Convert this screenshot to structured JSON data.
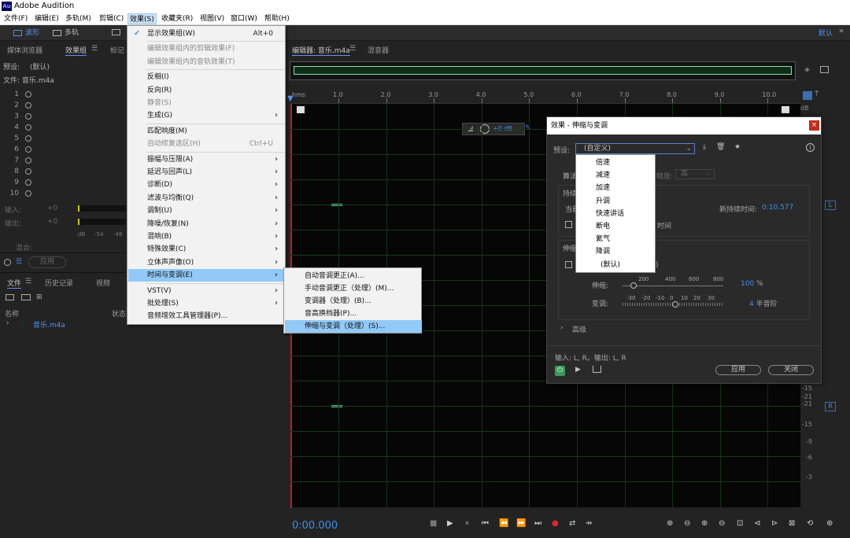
{
  "app": {
    "title": "Adobe Audition",
    "logo": "Au"
  },
  "menubar": [
    "文件(F)",
    "编辑(E)",
    "多轨(M)",
    "剪辑(C)",
    "效果(S)",
    "收藏夹(R)",
    "视图(V)",
    "窗口(W)",
    "帮助(H)"
  ],
  "toolbar": {
    "waveform": "波形",
    "multitrack": "多轨",
    "workspace": "默认"
  },
  "left_panel": {
    "tabs": [
      "媒体浏览器",
      "效果组",
      "标记"
    ],
    "preset_label": "预设:",
    "preset_value": "(默认)",
    "file_label": "文件: 音乐.m4a",
    "slots": [
      "1",
      "2",
      "3",
      "4",
      "5",
      "6",
      "7",
      "8",
      "9",
      "10"
    ],
    "input_label": "输入:",
    "output_label": "输出:",
    "mix_label": "混合:",
    "db_value": "+0",
    "meter_ticks": [
      "dB",
      "-54",
      "-48"
    ],
    "apply_button": "应用"
  },
  "files_panel": {
    "tabs": [
      "文件",
      "历史记录",
      "视频"
    ],
    "col_name": "名称",
    "col_status": "状态",
    "items": [
      "音乐.m4a"
    ]
  },
  "effects_menu": {
    "items": [
      {
        "label": "显示效果组(W)",
        "shortcut": "Alt+0",
        "checked": true
      },
      {
        "label": "编辑效果组内的剪辑效果(F)",
        "disabled": true
      },
      {
        "label": "编辑效果组内的音轨效果(T)",
        "disabled": true
      },
      {
        "label": "反相(I)"
      },
      {
        "label": "反向(R)"
      },
      {
        "label": "静音(S)",
        "disabled": true
      },
      {
        "label": "生成(G)",
        "submenu": true
      },
      {
        "label": "匹配响度(M)"
      },
      {
        "label": "自动修复选区(H)",
        "shortcut": "Ctrl+U",
        "disabled": true
      },
      {
        "label": "振幅与压限(A)",
        "submenu": true
      },
      {
        "label": "延迟与回声(L)",
        "submenu": true
      },
      {
        "label": "诊断(D)",
        "submenu": true
      },
      {
        "label": "滤波与均衡(Q)",
        "submenu": true
      },
      {
        "label": "调制(U)",
        "submenu": true
      },
      {
        "label": "降噪/恢复(N)",
        "submenu": true
      },
      {
        "label": "混响(B)",
        "submenu": true
      },
      {
        "label": "特殊效果(C)",
        "submenu": true
      },
      {
        "label": "立体声声像(O)",
        "submenu": true
      },
      {
        "label": "时间与变调(E)",
        "submenu": true,
        "highlight": true
      },
      {
        "label": "VST(V)",
        "submenu": true
      },
      {
        "label": "批处理(S)",
        "submenu": true
      },
      {
        "label": "音频增效工具管理器(P)..."
      }
    ]
  },
  "time_submenu": {
    "items": [
      {
        "label": "自动音调更正(A)..."
      },
      {
        "label": "手动音调更正（处理）(M)..."
      },
      {
        "label": "变调器（处理）(B)..."
      },
      {
        "label": "音高换档器(P)..."
      },
      {
        "label": "伸缩与变调（处理）(S)...",
        "highlight": true
      }
    ]
  },
  "editor": {
    "tabs": [
      "编辑器: 音乐.m4a",
      "混音器"
    ],
    "ruler_unit": "hms",
    "ruler": [
      "1.0",
      "2.0",
      "3.0",
      "4.0",
      "5.0",
      "6.0",
      "7.0",
      "8.0",
      "9.0",
      "10.0"
    ],
    "db_unit": "dB",
    "db_scale_bottom": [
      "-15",
      "-21",
      "-21",
      "-15",
      "-9",
      "-6",
      "-3"
    ],
    "hud_db": "+0 dB",
    "time_display": "0:00.000",
    "channel_left": "L",
    "channel_right": "R"
  },
  "dialog": {
    "title": "效果 - 伸缩与变调",
    "preset_label": "预设:",
    "preset_value": "(自定义)",
    "preset_options": [
      "倍速",
      "减速",
      "加速",
      "升调",
      "快速讲话",
      "断电",
      "氦气",
      "降调",
      "(默认)"
    ],
    "algorithm_label": "算法",
    "precision_label": "精度:",
    "precision_value": "高",
    "duration_label": "持续",
    "current_label": "当前",
    "new_duration_label": "新持续时间:",
    "new_duration_value": "0:10.577",
    "lock_duration_label": "时间",
    "stretch_section": "伸缩",
    "stretch_label": "伸缩:",
    "stretch_ticks": [
      "200",
      "400",
      "600",
      "800"
    ],
    "stretch_value": "100",
    "stretch_unit": "%",
    "pitch_label": "变调:",
    "pitch_ticks": [
      "-30",
      "-20",
      "-10",
      "0",
      "10",
      "20",
      "30"
    ],
    "pitch_value": "4",
    "pitch_unit": "半音阶",
    "advanced_label": "高级",
    "io_label": "输入: L, R。输出: L, R",
    "apply_button": "应用",
    "close_button": "关闭",
    "close_x": "×"
  }
}
